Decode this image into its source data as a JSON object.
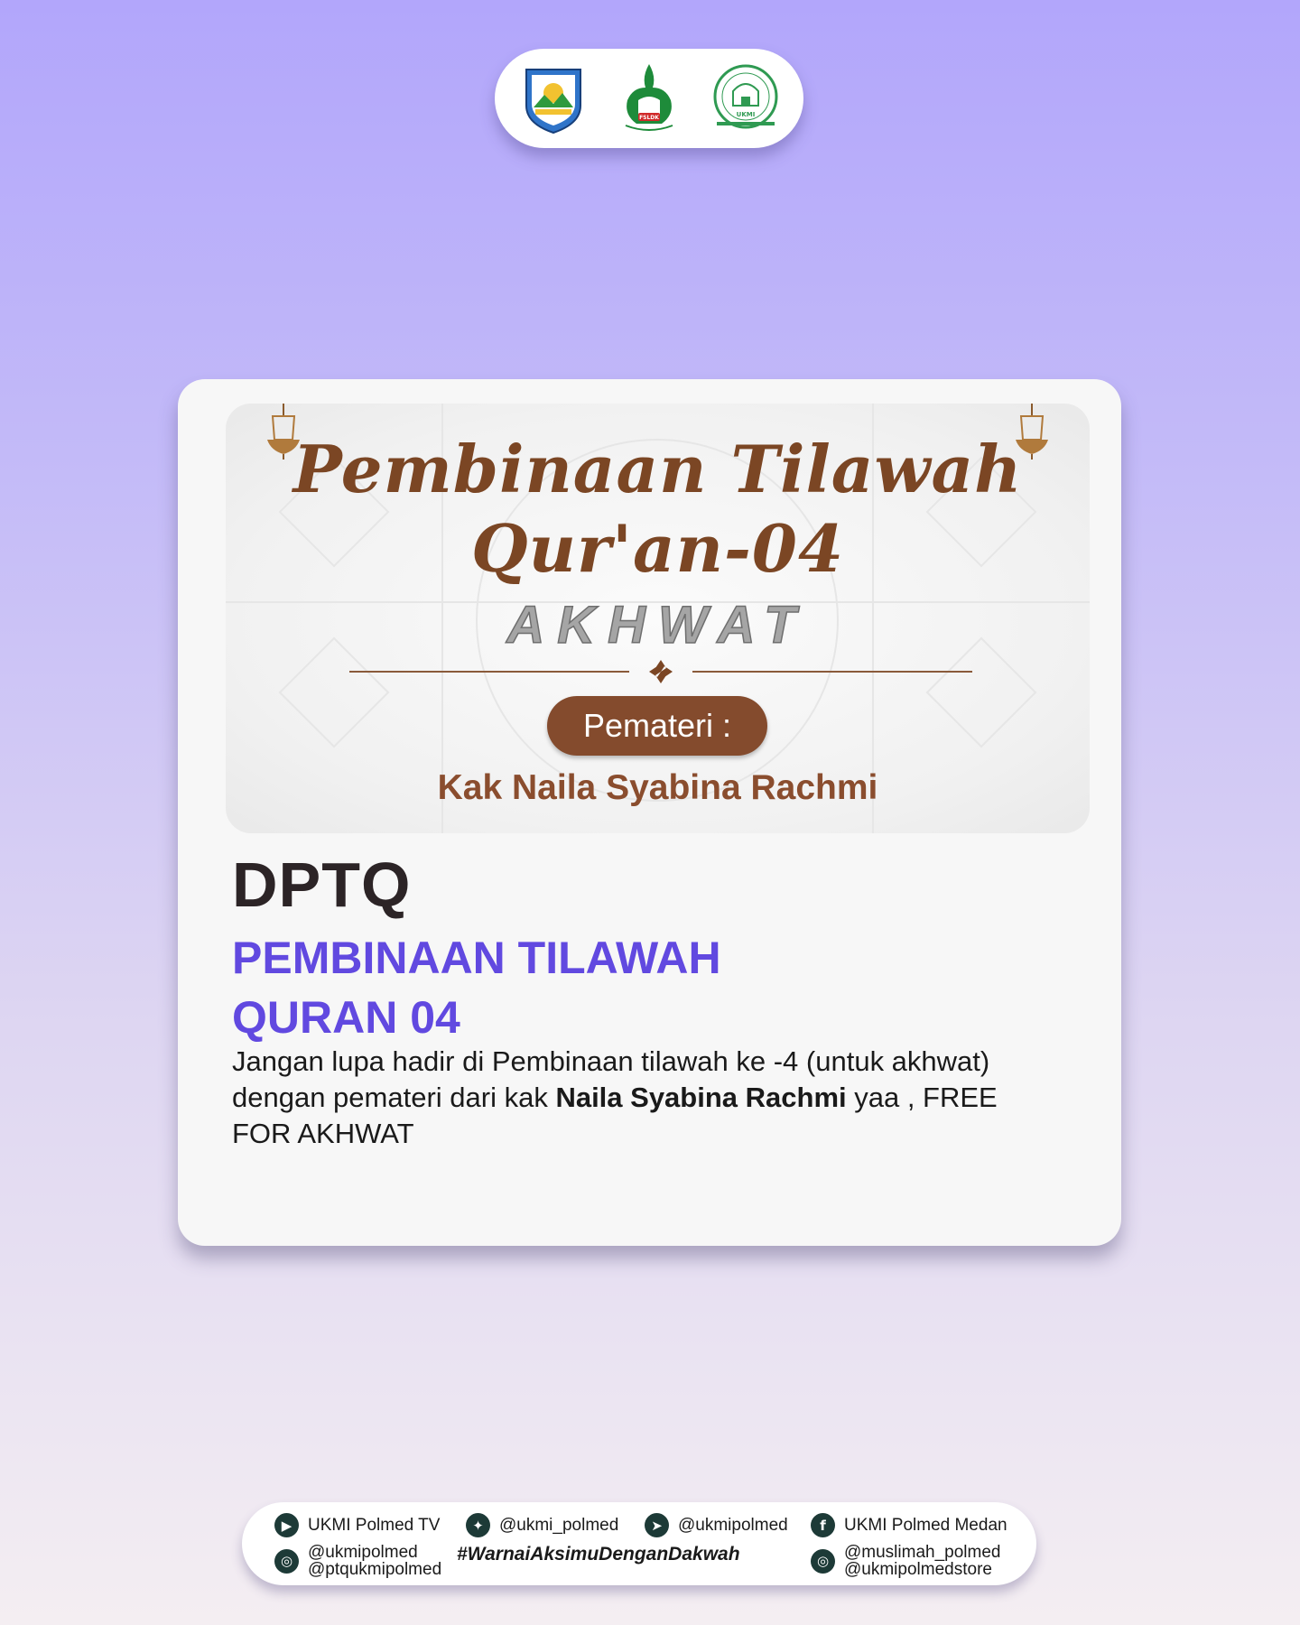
{
  "logos": [
    {
      "name": "polmed-logo"
    },
    {
      "name": "fsldk-logo",
      "text": "FSLDK"
    },
    {
      "name": "ukmi-logo",
      "text": "UKMI"
    }
  ],
  "banner": {
    "title_line1": "Pembinaan Tilawah",
    "title_line2": "Qur'an-04",
    "audience": "AKHWAT",
    "speaker_label": "Pemateri :",
    "speaker_name": "Kak Naila Syabina Rachmi"
  },
  "content": {
    "org": "DPTQ",
    "title_line1": "PEMBINAAN TILAWAH",
    "title_line2": "QURAN 04",
    "desc_part1": "Jangan lupa hadir di Pembinaan tilawah ke -4 (untuk akhwat) dengan pemateri dari kak ",
    "desc_bold": "Naila Syabina Rachmi",
    "desc_part2": " yaa , FREE FOR AKHWAT"
  },
  "social": {
    "youtube": "UKMI Polmed TV",
    "twitter": "@ukmi_polmed",
    "telegram": "@ukmipolmed",
    "facebook": "UKMI Polmed Medan",
    "instagram_left_1": "@ukmipolmed",
    "instagram_left_2": "@ptqukmipolmed",
    "hashtag": "#WarnaiAksimuDenganDakwah",
    "instagram_right_1": "@muslimah_polmed",
    "instagram_right_2": "@ukmipolmedstore"
  },
  "colors": {
    "accent_purple": "#6149e0",
    "brown": "#844b2d",
    "dark_text": "#2c2426"
  }
}
